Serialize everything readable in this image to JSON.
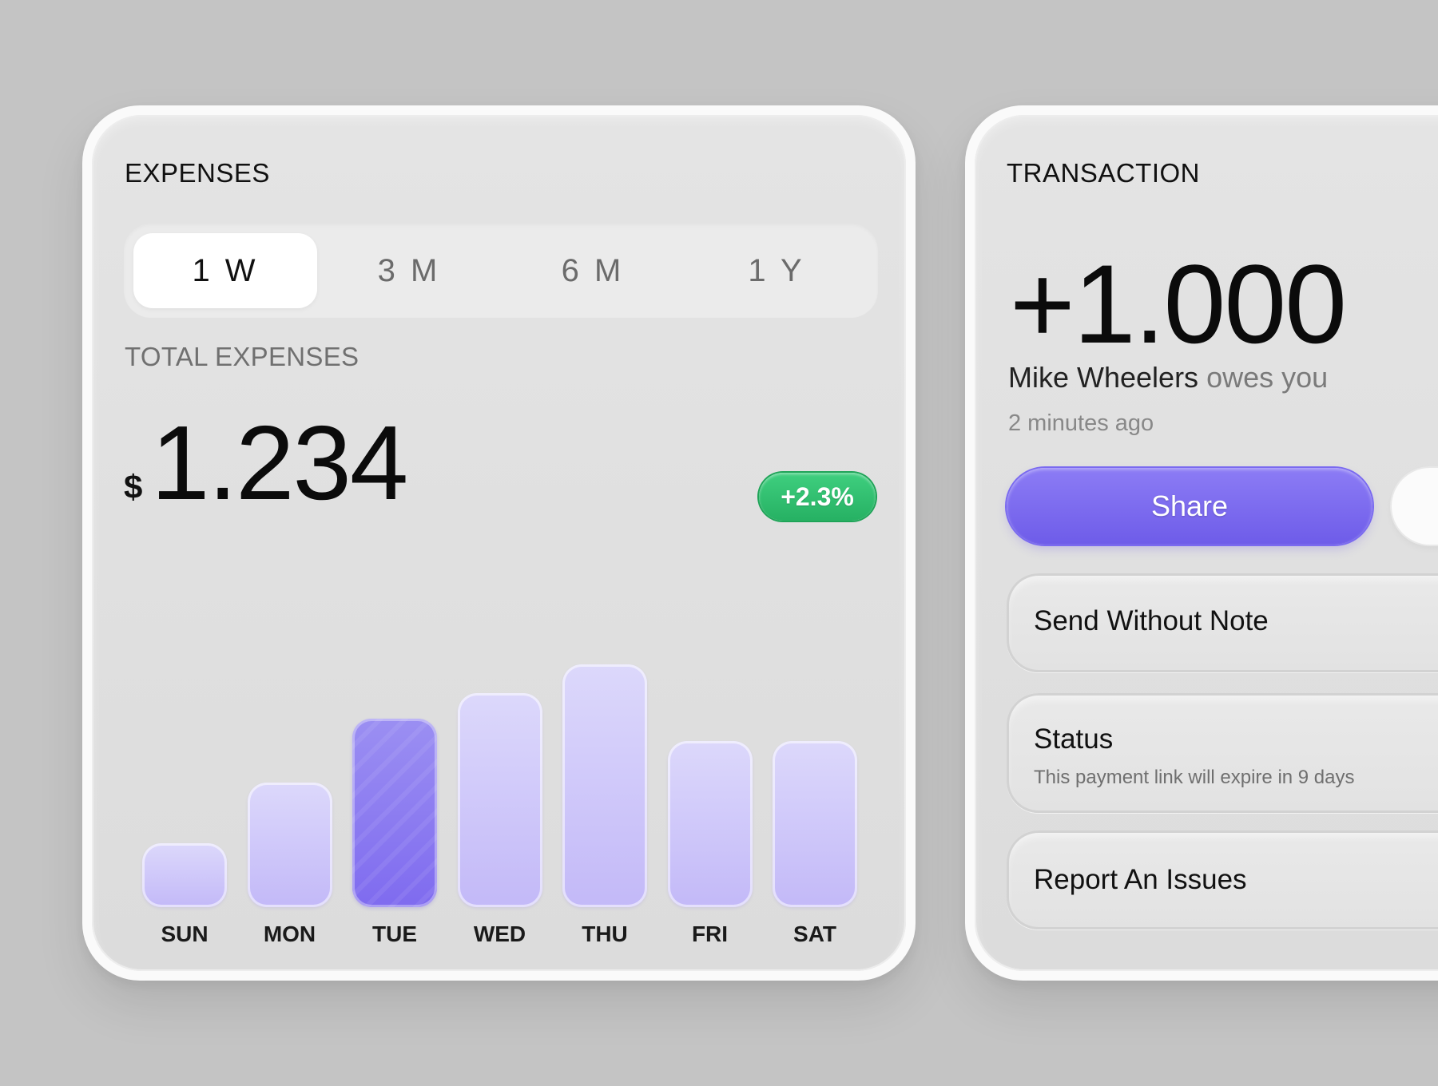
{
  "expenses": {
    "title": "EXPENSES",
    "tabs": [
      {
        "label": "1 W",
        "active": true
      },
      {
        "label": "3 M",
        "active": false
      },
      {
        "label": "6 M",
        "active": false
      },
      {
        "label": "1 Y",
        "active": false
      }
    ],
    "total_label": "TOTAL EXPENSES",
    "currency": "$",
    "total_value": "1.234",
    "change_badge": "+2.3%",
    "colors": {
      "bar": "#c9c0f9",
      "bar_highlight": "#8575f0",
      "badge": "#2fbf6e"
    }
  },
  "chart_data": {
    "type": "bar",
    "categories": [
      "SUN",
      "MON",
      "TUE",
      "WED",
      "THU",
      "FRI",
      "SAT"
    ],
    "values": [
      20,
      39,
      59,
      67,
      76,
      52,
      52
    ],
    "highlight_index": 2,
    "title": "",
    "xlabel": "",
    "ylabel": "",
    "ylim": [
      0,
      100
    ],
    "grid": false
  },
  "transaction": {
    "title": "TRANSACTION",
    "amount": "+1.000",
    "name": "Mike Wheelers",
    "owes_text": "owes you",
    "time": "2 minutes ago",
    "share_label": "Share",
    "colors": {
      "share": "#7a68ef"
    },
    "options": [
      {
        "label": "Send Without Note"
      },
      {
        "label": "Status",
        "sub": "This payment link will expire in 9 days"
      },
      {
        "label": "Report An Issues"
      }
    ]
  }
}
